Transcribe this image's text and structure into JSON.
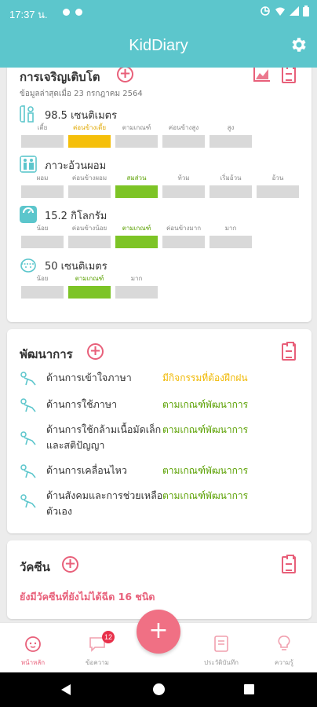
{
  "status_bar": {
    "time": "17:37 น."
  },
  "app": {
    "title": "KidDiary"
  },
  "growth": {
    "title": "การเจริญเติบโต",
    "updated": "ข้อมูลล่าสุดเมื่อ 23 กรกฎาคม 2564",
    "height": {
      "value": "98.5 เซนติเมตร",
      "labels": [
        "เตี้ย",
        "ค่อนข้างเตี้ย",
        "ตามเกณฑ์",
        "ค่อนข้างสูง",
        "สูง"
      ],
      "active_index": 1
    },
    "weight_for_height": {
      "value": "ภาวะอ้วนผอม",
      "labels": [
        "ผอม",
        "ค่อนข้างผอม",
        "สมส่วน",
        "ท้วม",
        "เริ่มอ้วน",
        "อ้วน"
      ],
      "active_index": 2
    },
    "weight": {
      "value": "15.2 กิโลกรัม",
      "labels": [
        "น้อย",
        "ค่อนข้างน้อย",
        "ตามเกณฑ์",
        "ค่อนข้างมาก",
        "มาก"
      ],
      "active_index": 2
    },
    "head": {
      "value": "50 เซนติเมตร",
      "labels": [
        "น้อย",
        "ตามเกณฑ์",
        "มาก"
      ],
      "active_index": 1
    }
  },
  "development": {
    "title": "พัฒนาการ",
    "items": [
      {
        "label": "ด้านการเข้าใจภาษา",
        "status": "มีกิจกรรมที่ต้องฝึกฝน",
        "tone": "yellow"
      },
      {
        "label": "ด้านการใช้ภาษา",
        "status": "ตามเกณฑ์พัฒนาการ",
        "tone": "green"
      },
      {
        "label": "ด้านการใช้กล้ามเนื้อมัดเล็กและสติปัญญา",
        "status": "ตามเกณฑ์พัฒนาการ",
        "tone": "green"
      },
      {
        "label": "ด้านการเคลื่อนไหว",
        "status": "ตามเกณฑ์พัฒนาการ",
        "tone": "green"
      },
      {
        "label": "ด้านสังคมและการช่วยเหลือตัวเอง",
        "status": "ตามเกณฑ์พัฒนาการ",
        "tone": "green"
      }
    ]
  },
  "vaccine": {
    "title": "วัคซีน",
    "alert": "ยังมีวัคซีนที่ยังไม่ได้ฉีด 16 ชนิด"
  },
  "bottom_nav": {
    "home": "หน้าหลัก",
    "messages": "ข้อความ",
    "messages_badge": "12",
    "fab": "+",
    "record": "ประวัติบันทึก",
    "knowledge": "ความรู้"
  },
  "colors": {
    "primary": "#5cc6cc",
    "accent": "#e8607a",
    "yellow": "#f5bf0a",
    "green": "#7dc426"
  }
}
